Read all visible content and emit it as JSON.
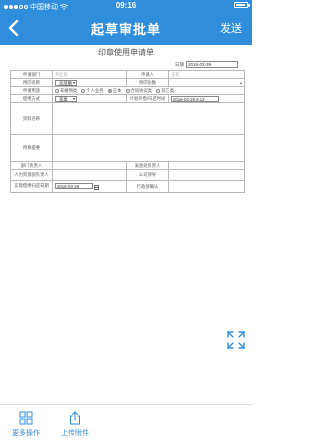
{
  "statusbar": {
    "carrier": "中国移动",
    "time": "09:16",
    "battery": ""
  },
  "navbar": {
    "title": "起草审批单",
    "send_label": "发送"
  },
  "form": {
    "title": "印章使用申请单",
    "date_label": "日期",
    "date_value": "2016-03-29",
    "rows": {
      "apply_dept_label": "申请部门",
      "apply_dept_value": "外区处",
      "applicant_label": "申请人",
      "applicant_value": "王军",
      "seal_name_label": "用印名称",
      "seal_name_value": "总部圈",
      "copies_label": "用印份数",
      "purpose_label": "申请用途",
      "purpose_options": [
        "非婚佣类",
        "个人业务",
        "正本",
        "合同协议类",
        "其它类"
      ],
      "purpose_selected_index": 2,
      "usage_label": "使用方式",
      "usage_value": "盖章",
      "plan_time_label": "计划外借/归还时间",
      "plan_time_value": "2016-03-29 9:13",
      "materials_label": "资料名称",
      "notes_label": "用章提要",
      "dept_head_label": "部门负责人",
      "office_label": "发放处负责人",
      "hr_label": "人力资源部负责人",
      "company_leader_label": "公司领导",
      "return_date_label": "实际借用归还日期",
      "return_date_value": "2016-03-29",
      "admin_label": "行政部确认"
    }
  },
  "bottom": {
    "more_label": "更多操作",
    "upload_label": "上传附件"
  },
  "colors": {
    "brand": "#2f8ddb"
  }
}
